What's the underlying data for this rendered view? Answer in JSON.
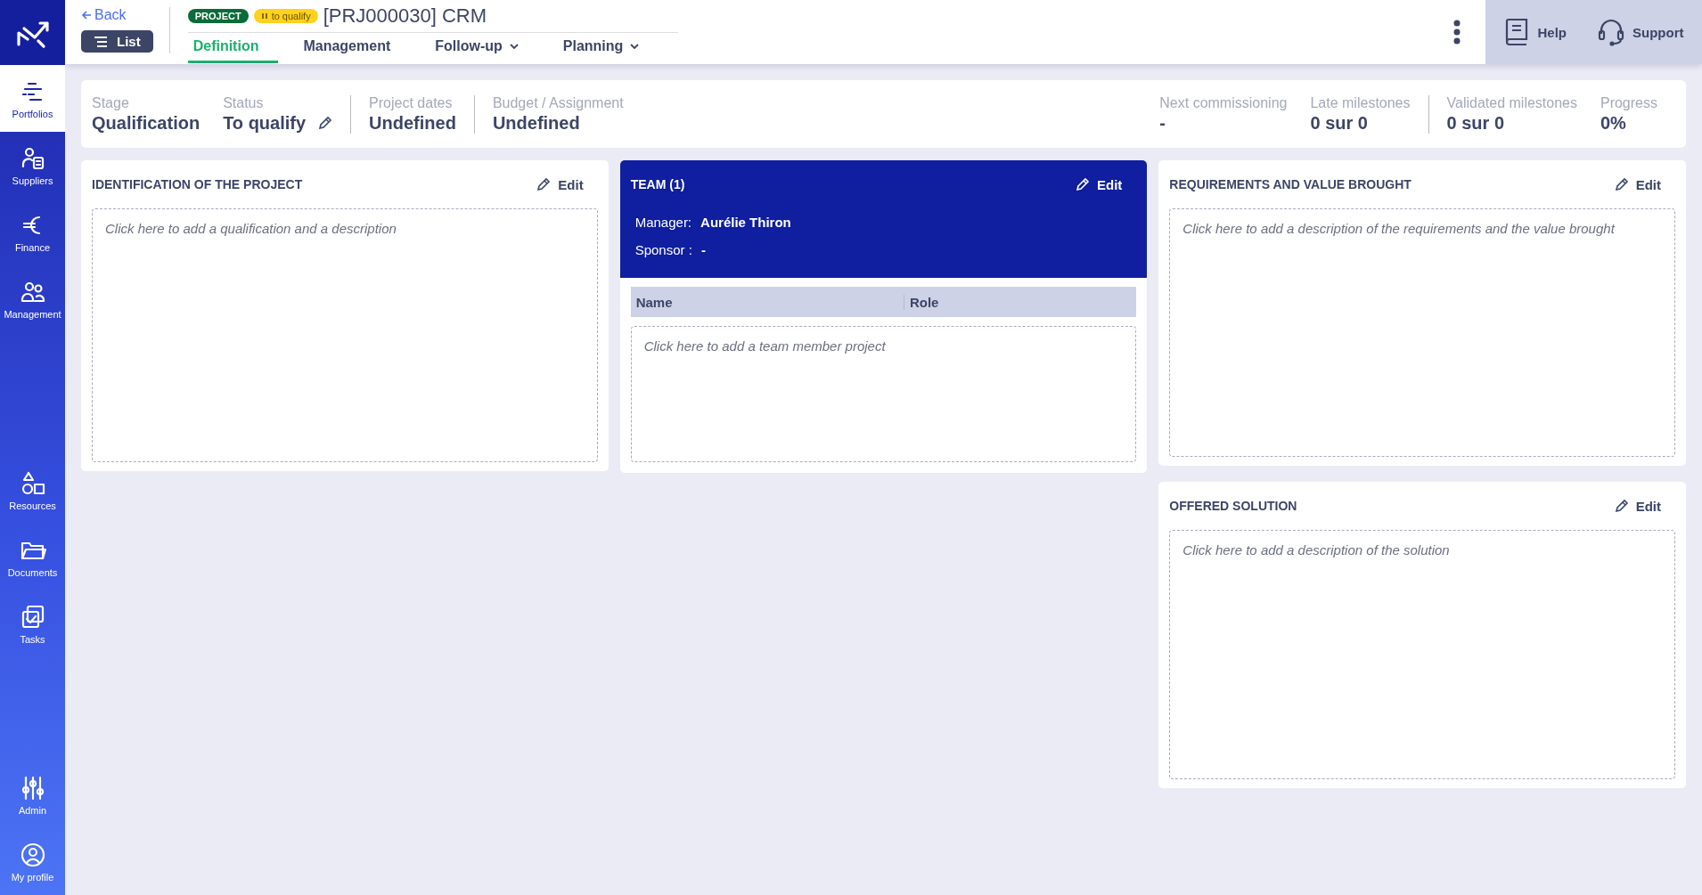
{
  "sidebar": {
    "sections": [
      {
        "items": [
          {
            "label": "Portfolios",
            "selected": true
          },
          {
            "label": "Suppliers",
            "selected": false
          },
          {
            "label": "Finance",
            "selected": false
          },
          {
            "label": "Management",
            "selected": false
          }
        ]
      },
      {
        "items": [
          {
            "label": "Resources",
            "selected": false
          },
          {
            "label": "Documents",
            "selected": false
          },
          {
            "label": "Tasks",
            "selected": false
          }
        ]
      },
      {
        "items": [
          {
            "label": "Admin",
            "selected": false
          },
          {
            "label": "My profile",
            "selected": false
          }
        ]
      }
    ]
  },
  "header": {
    "back": "Back",
    "list_button": "List",
    "badges": [
      {
        "label": "PROJECT",
        "kind": "type"
      },
      {
        "label": "to qualify",
        "kind": "status"
      }
    ],
    "title": "[PRJ000030] CRM",
    "tabs": [
      {
        "label": "Definition",
        "selected": true,
        "dropdown": false
      },
      {
        "label": "Management",
        "selected": false,
        "dropdown": false
      },
      {
        "label": "Follow-up",
        "selected": false,
        "dropdown": true
      },
      {
        "label": "Planning",
        "selected": false,
        "dropdown": true
      }
    ],
    "help": "Help",
    "support": "Support"
  },
  "summary": {
    "left": [
      [
        {
          "label": "Stage",
          "value": "Qualification",
          "editable": false
        },
        {
          "label": "Status",
          "value": "To qualify",
          "editable": true
        }
      ],
      [
        {
          "label": "Project dates",
          "value": "Undefined",
          "editable": false
        }
      ],
      [
        {
          "label": "Budget / Assignment",
          "value": "Undefined",
          "editable": false
        }
      ]
    ],
    "right": [
      [
        {
          "label": "Next commissioning",
          "value": "-",
          "editable": false
        },
        {
          "label": "Late milestones",
          "value": "0 sur 0",
          "editable": false
        }
      ],
      [
        {
          "label": "Validated milestones",
          "value": "0 sur 0",
          "editable": false
        },
        {
          "label": "Progress",
          "value": "0%",
          "editable": false
        }
      ]
    ]
  },
  "columns": [
    [
      {
        "kind": "text",
        "title": "IDENTIFICATION OF THE PROJECT",
        "edit": "Edit",
        "placeholder": "Click here to add a qualification and a description"
      }
    ],
    [
      {
        "kind": "team",
        "title": "TEAM (1)",
        "edit": "Edit",
        "manager_label": "Manager:",
        "manager": "Aurélie Thiron",
        "sponsor_label": "Sponsor :",
        "sponsor": "-",
        "table_columns": [
          "Name",
          "Role"
        ],
        "placeholder": "Click here to add a team member project"
      }
    ],
    [
      {
        "kind": "text",
        "title": "REQUIREMENTS AND VALUE BROUGHT",
        "edit": "Edit",
        "placeholder": "Click here to add a description of the requirements and the value brought"
      },
      {
        "kind": "text",
        "title": "OFFERED SOLUTION",
        "edit": "Edit",
        "placeholder": "Click here to add a description of the solution"
      }
    ]
  ]
}
